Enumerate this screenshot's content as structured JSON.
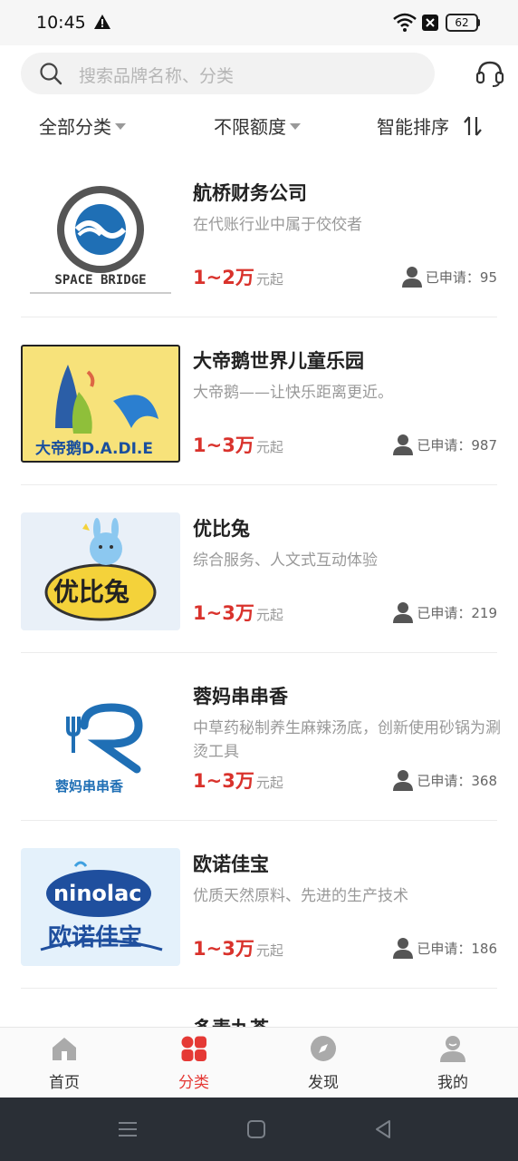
{
  "status_bar": {
    "time": "10:45",
    "battery": "62"
  },
  "search": {
    "placeholder": "搜索品牌名称、分类"
  },
  "filters": [
    {
      "label": "全部分类"
    },
    {
      "label": "不限额度"
    },
    {
      "label": "智能排序"
    }
  ],
  "brands": [
    {
      "name": "航桥财务公司",
      "desc": "在代账行业中属于佼佼者",
      "range": "1~2万",
      "range_suffix": "元起",
      "applied": "已申请：95",
      "logo_text": "SPACE BRIDGE"
    },
    {
      "name": "大帝鹅世界儿童乐园",
      "desc": "大帝鹅——让快乐距离更近。",
      "range": "1~3万",
      "range_suffix": "元起",
      "applied": "已申请：987",
      "logo_text": "大帝鹅D.A.DI.E"
    },
    {
      "name": "优比兔",
      "desc": "综合服务、人文式互动体验",
      "range": "1~3万",
      "range_suffix": "元起",
      "applied": "已申请：219",
      "logo_text": "优比兔"
    },
    {
      "name": "蓉妈串串香",
      "desc": "中草药秘制养生麻辣汤底，创新使用砂锅为涮烫工具",
      "range": "1~3万",
      "range_suffix": "元起",
      "applied": "已申请：368",
      "logo_text": "蓉妈串串香"
    },
    {
      "name": "欧诺佳宝",
      "desc": "优质天然原料、先进的生产技术",
      "range": "1~3万",
      "range_suffix": "元起",
      "applied": "已申请：186",
      "logo_text": "ninolac",
      "logo_text2": "欧诺佳宝"
    }
  ],
  "peek_item": {
    "name": "多麦九茶"
  },
  "bottom_nav": [
    {
      "label": "首页",
      "icon": "home-icon"
    },
    {
      "label": "分类",
      "icon": "category-icon",
      "active": true
    },
    {
      "label": "发现",
      "icon": "discover-icon"
    },
    {
      "label": "我的",
      "icon": "profile-icon"
    }
  ],
  "colors": {
    "accent": "#d9322c",
    "nav_active": "#e53935",
    "system_bar": "#2a2f36"
  }
}
